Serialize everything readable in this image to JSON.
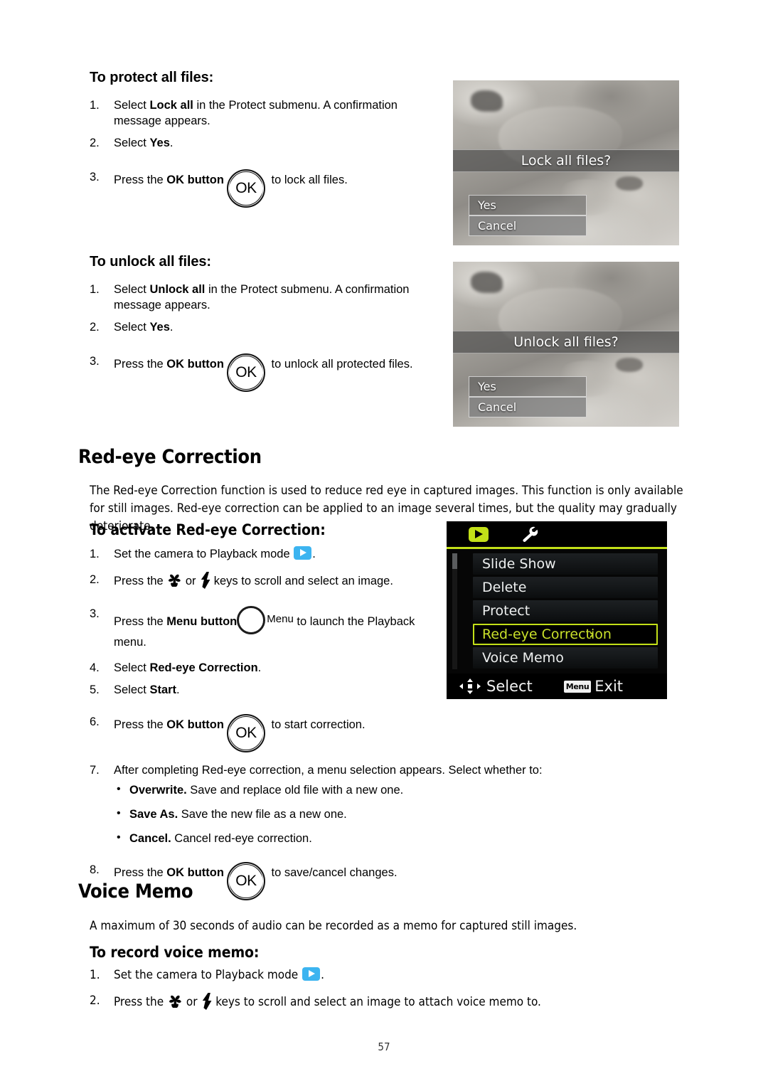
{
  "page": {
    "number": "57"
  },
  "section_protect": {
    "heading": "To protect all files:",
    "steps": [
      {
        "num": "1.",
        "pre": "Select ",
        "bold": "Lock all",
        "post": " in the Protect submenu. A confirmation message appears."
      },
      {
        "num": "2.",
        "pre": "Select ",
        "bold": "Yes",
        "post": "."
      },
      {
        "num": "3.",
        "pre": "Press the ",
        "bold": "OK button",
        "post": " to lock all files."
      }
    ]
  },
  "section_unlock": {
    "heading": "To unlock all files:",
    "steps": [
      {
        "num": "1.",
        "pre": "Select ",
        "bold": "Unlock all",
        "post": " in the Protect submenu. A confirmation message appears."
      },
      {
        "num": "2.",
        "pre": "Select ",
        "bold": "Yes",
        "post": "."
      },
      {
        "num": "3.",
        "pre": "Press the ",
        "bold": "OK button",
        "post": " to unlock all protected files."
      }
    ]
  },
  "screenshot_lock": {
    "title": "Lock all files?",
    "options": [
      {
        "label": "Yes",
        "selected": false
      },
      {
        "label": "Cancel",
        "selected": true
      }
    ]
  },
  "screenshot_unlock": {
    "title": "Unlock all files?",
    "options": [
      {
        "label": "Yes",
        "selected": false
      },
      {
        "label": "Cancel",
        "selected": true
      }
    ]
  },
  "section_redeye": {
    "heading": "Red-eye Correction",
    "intro": "The Red-eye Correction function is used to reduce red eye in captured images. This function is only available for still images. Red-eye correction can be applied to an image several times, but the quality may gradually deteriorate.",
    "subheading": "To activate Red-eye Correction:",
    "steps": [
      {
        "num": "1.",
        "pre": "Set the camera to Playback mode ",
        "bold": "",
        "post": "."
      },
      {
        "num": "2.",
        "pre": "Press the ",
        "bold": "",
        "post": " keys to scroll and select an image."
      },
      {
        "num": "3.",
        "pre": "Press the ",
        "bold": "Menu button",
        "post": " to launch the Playback menu."
      },
      {
        "num": "4.",
        "pre": "Select ",
        "bold": "Red-eye Correction",
        "post": "."
      },
      {
        "num": "5.",
        "pre": "Select ",
        "bold": "Start",
        "post": "."
      },
      {
        "num": "6.",
        "pre": "Press the ",
        "bold": "OK button",
        "post": " to start correction."
      },
      {
        "num": "7.",
        "pre": "After completing Red-eye correction, a menu selection appears. Select whether to:",
        "bold": "",
        "post": ""
      },
      {
        "num": "8.",
        "pre": "Press the ",
        "bold": "OK button",
        "post": " to save/cancel changes."
      }
    ],
    "bullets": [
      {
        "bold": "Overwrite.",
        "text": " Save and replace old file with a new one."
      },
      {
        "bold": "Save As.",
        "text": " Save the new file as a new one."
      },
      {
        "bold": "Cancel.",
        "text": " Cancel red-eye correction."
      }
    ]
  },
  "playback_menu": {
    "tabs": [
      {
        "icon": "playback-icon",
        "active": true
      },
      {
        "icon": "wrench-icon",
        "active": false
      }
    ],
    "items": [
      {
        "label": "Slide Show",
        "active": false,
        "chevron": ""
      },
      {
        "label": "Delete",
        "active": false,
        "chevron": ""
      },
      {
        "label": "Protect",
        "active": false,
        "chevron": ""
      },
      {
        "label": "Red-eye Correction",
        "active": true,
        "chevron": "›"
      },
      {
        "label": "Voice Memo",
        "active": false,
        "chevron": ""
      }
    ],
    "footer": {
      "select_label": "Select",
      "menu_badge": "Menu",
      "exit_label": "Exit"
    },
    "accent_color": "#c3e018"
  },
  "section_voicememo": {
    "heading": "Voice Memo",
    "intro": "A maximum of 30 seconds of audio can be recorded as a memo for captured still images.",
    "subheading": "To record voice memo:",
    "steps": [
      {
        "num": "1.",
        "pre": "Set the camera to Playback mode ",
        "bold": "",
        "post": "."
      },
      {
        "num": "2.",
        "pre": "Press the ",
        "bold": "",
        "post": " keys to scroll and select an image to attach voice memo to."
      }
    ]
  },
  "icons": {
    "ok_label": "OK",
    "menu_label": "Menu",
    "playback": "playback-mode-icon",
    "macro": "macro-flower-icon",
    "flash": "flash-bolt-icon",
    "wrench": "wrench-icon",
    "dpad": "dpad-icon"
  }
}
